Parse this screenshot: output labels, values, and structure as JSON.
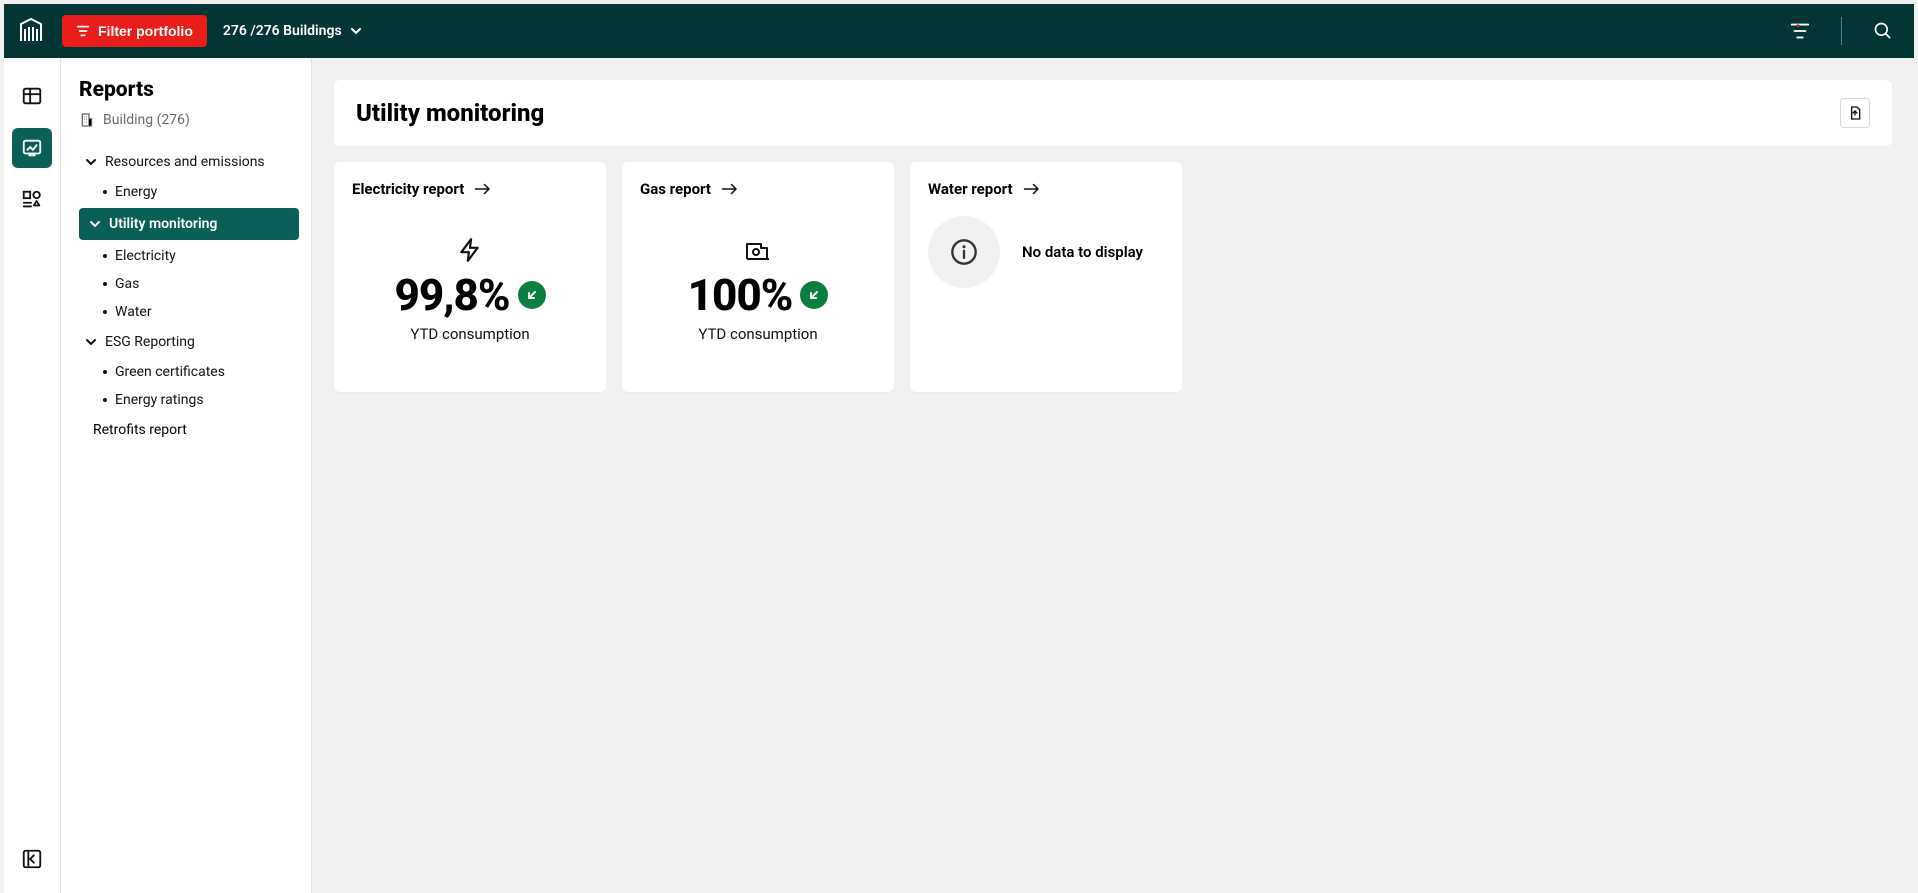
{
  "topbar": {
    "filter_label": "Filter portfolio",
    "buildings_text": "276 /276 Buildings"
  },
  "sidebar": {
    "title": "Reports",
    "scope_label": "Building (276)",
    "group_resources": "Resources and emissions",
    "item_energy": "Energy",
    "item_utility": "Utility monitoring",
    "item_electricity": "Electricity",
    "item_gas": "Gas",
    "item_water": "Water",
    "group_esg": "ESG Reporting",
    "item_green": "Green certificates",
    "item_ratings": "Energy ratings",
    "item_retrofits": "Retrofits report"
  },
  "page": {
    "title": "Utility monitoring"
  },
  "cards": {
    "electricity": {
      "title": "Electricity report",
      "value": "99,8%",
      "caption": "YTD consumption"
    },
    "gas": {
      "title": "Gas report",
      "value": "100%",
      "caption": "YTD consumption"
    },
    "water": {
      "title": "Water report",
      "nodata": "No data to display"
    }
  }
}
